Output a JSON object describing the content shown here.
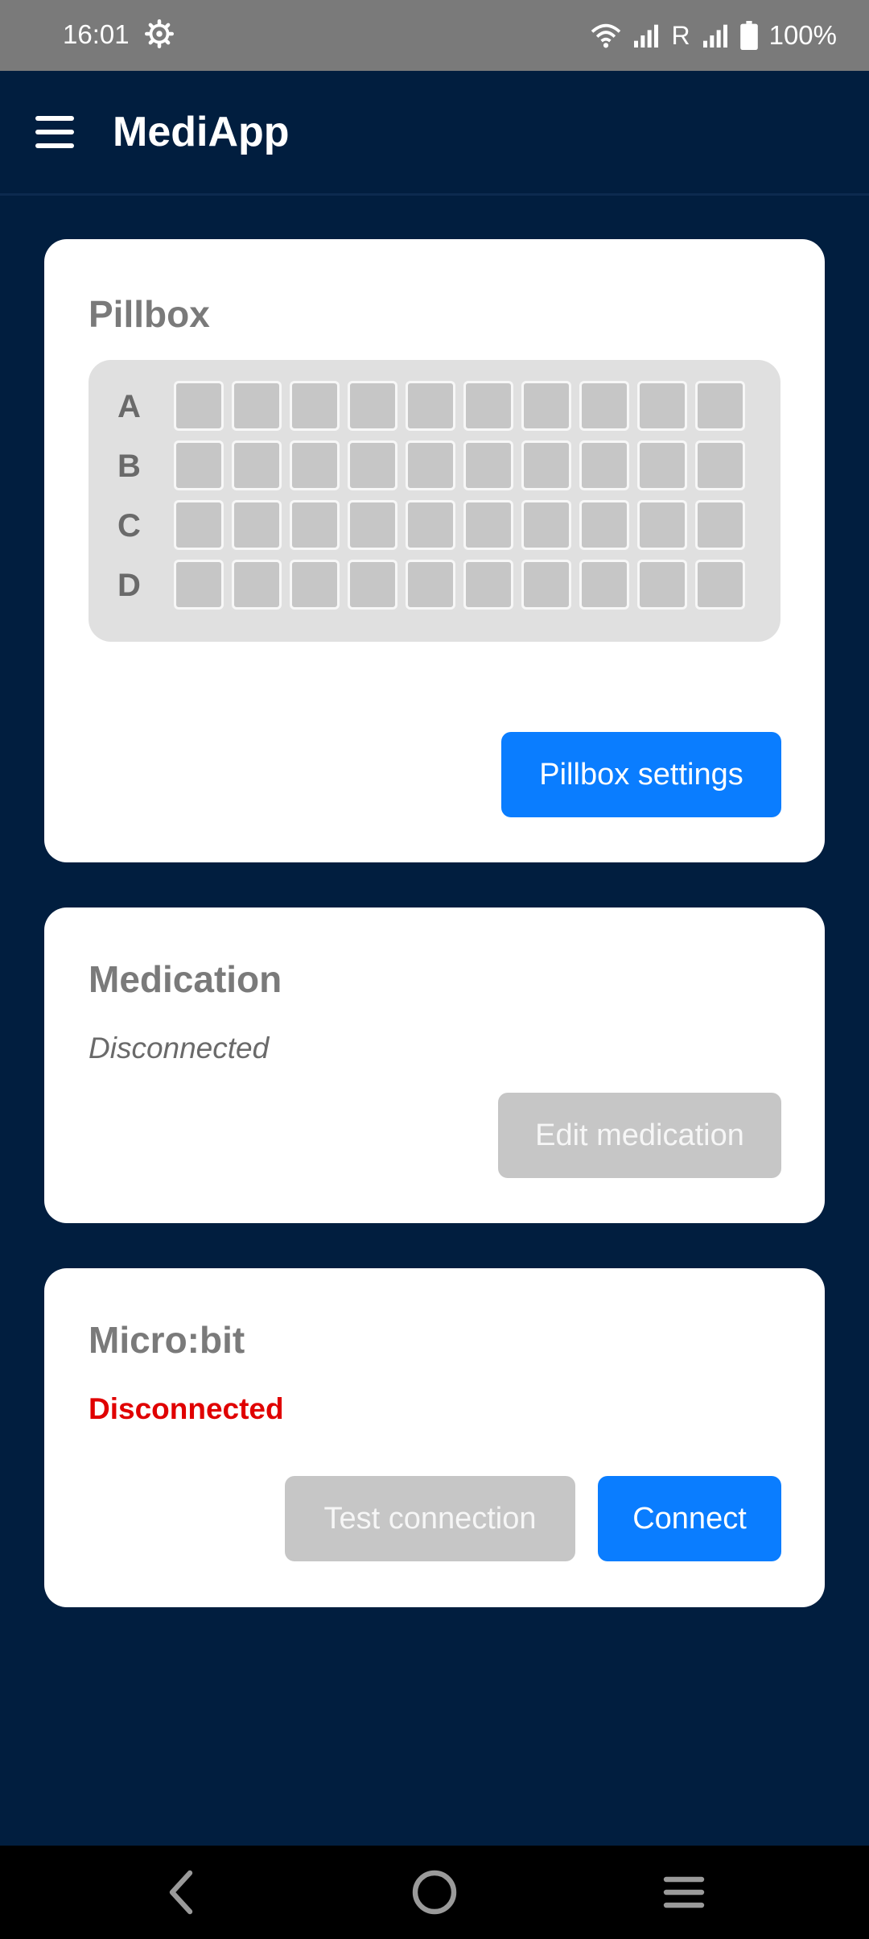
{
  "status_bar": {
    "time": "16:01",
    "carrier": "R",
    "battery": "100%"
  },
  "app_bar": {
    "title": "MediApp"
  },
  "pillbox": {
    "title": "Pillbox",
    "rows": [
      "A",
      "B",
      "C",
      "D"
    ],
    "columns": 10,
    "settings_button": "Pillbox settings"
  },
  "medication": {
    "title": "Medication",
    "status": "Disconnected",
    "edit_button": "Edit medication"
  },
  "microbit": {
    "title": "Micro:bit",
    "status": "Disconnected",
    "test_button": "Test connection",
    "connect_button": "Connect"
  },
  "colors": {
    "background": "#011e3f",
    "accent": "#0a7dff",
    "error": "#e00000",
    "disabled": "#c6c6c6"
  }
}
